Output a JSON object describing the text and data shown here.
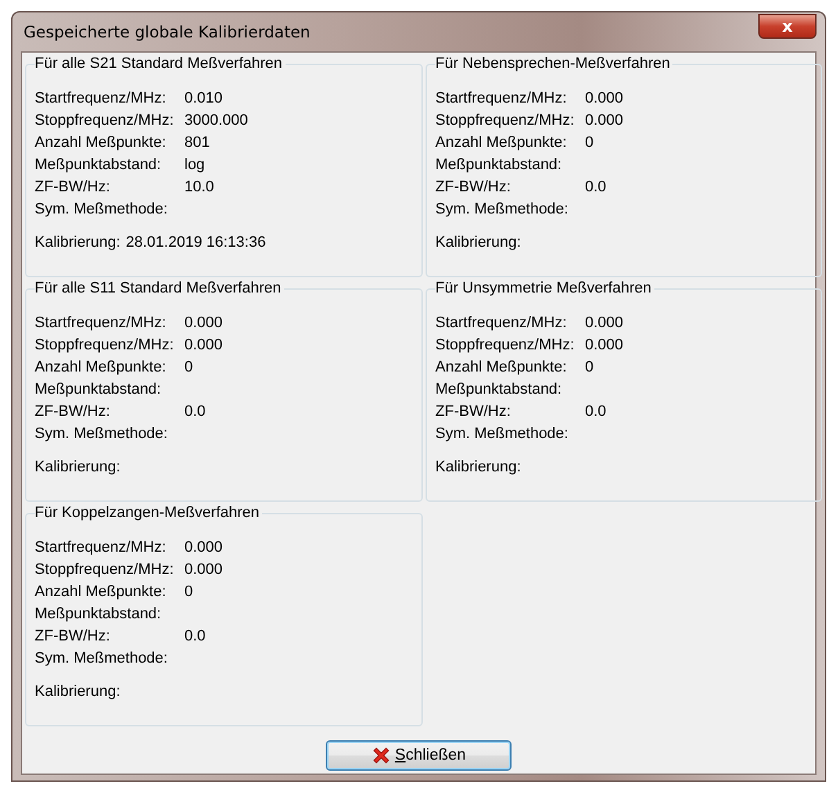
{
  "window": {
    "title": "Gespeicherte globale Kalibrierdaten",
    "close_glyph": "x"
  },
  "groups": [
    {
      "title": "Für alle S21 Standard Meßverfahren",
      "rows": [
        {
          "label": "Startfrequenz/MHz:",
          "value": "0.010"
        },
        {
          "label": "Stoppfrequenz/MHz:",
          "value": "3000.000"
        },
        {
          "label": "Anzahl Meßpunkte:",
          "value": "801"
        },
        {
          "label": "Meßpunktabstand:",
          "value": "log"
        },
        {
          "label": "ZF-BW/Hz:",
          "value": "10.0"
        },
        {
          "label": "Sym. Meßmethode:"
        }
      ],
      "calibration": {
        "label": "Kalibrierung:",
        "value": "28.01.2019 16:13:36"
      }
    },
    {
      "title": "Für Nebensprechen-Meßverfahren",
      "rows": [
        {
          "label": "Startfrequenz/MHz:",
          "value": "0.000"
        },
        {
          "label": "Stoppfrequenz/MHz:",
          "value": "0.000"
        },
        {
          "label": "Anzahl Meßpunkte:",
          "value": "0"
        },
        {
          "label": "Meßpunktabstand:"
        },
        {
          "label": "ZF-BW/Hz:",
          "value": "0.0"
        },
        {
          "label": "Sym. Meßmethode:"
        }
      ],
      "calibration": {
        "label": "Kalibrierung:"
      }
    },
    {
      "title": "Für alle S11 Standard Meßverfahren",
      "rows": [
        {
          "label": "Startfrequenz/MHz:",
          "value": "0.000"
        },
        {
          "label": "Stoppfrequenz/MHz:",
          "value": "0.000"
        },
        {
          "label": "Anzahl Meßpunkte:",
          "value": "0"
        },
        {
          "label": "Meßpunktabstand:"
        },
        {
          "label": "ZF-BW/Hz:",
          "value": "0.0"
        },
        {
          "label": "Sym. Meßmethode:"
        }
      ],
      "calibration": {
        "label": "Kalibrierung:"
      }
    },
    {
      "title": "Für Unsymmetrie Meßverfahren",
      "rows": [
        {
          "label": "Startfrequenz/MHz:",
          "value": "0.000"
        },
        {
          "label": "Stoppfrequenz/MHz:",
          "value": "0.000"
        },
        {
          "label": "Anzahl Meßpunkte:",
          "value": "0"
        },
        {
          "label": "Meßpunktabstand:"
        },
        {
          "label": "ZF-BW/Hz:",
          "value": "0.0"
        },
        {
          "label": "Sym. Meßmethode:"
        }
      ],
      "calibration": {
        "label": "Kalibrierung:"
      }
    },
    {
      "title": "Für Koppelzangen-Meßverfahren",
      "rows": [
        {
          "label": "Startfrequenz/MHz:",
          "value": "0.000"
        },
        {
          "label": "Stoppfrequenz/MHz:",
          "value": "0.000"
        },
        {
          "label": "Anzahl Meßpunkte:",
          "value": "0"
        },
        {
          "label": "Meßpunktabstand:"
        },
        {
          "label": "ZF-BW/Hz:",
          "value": "0.0"
        },
        {
          "label": "Sym. Meßmethode:"
        }
      ],
      "calibration": {
        "label": "Kalibrierung:"
      }
    }
  ],
  "close_button": {
    "label": "Schließen"
  }
}
